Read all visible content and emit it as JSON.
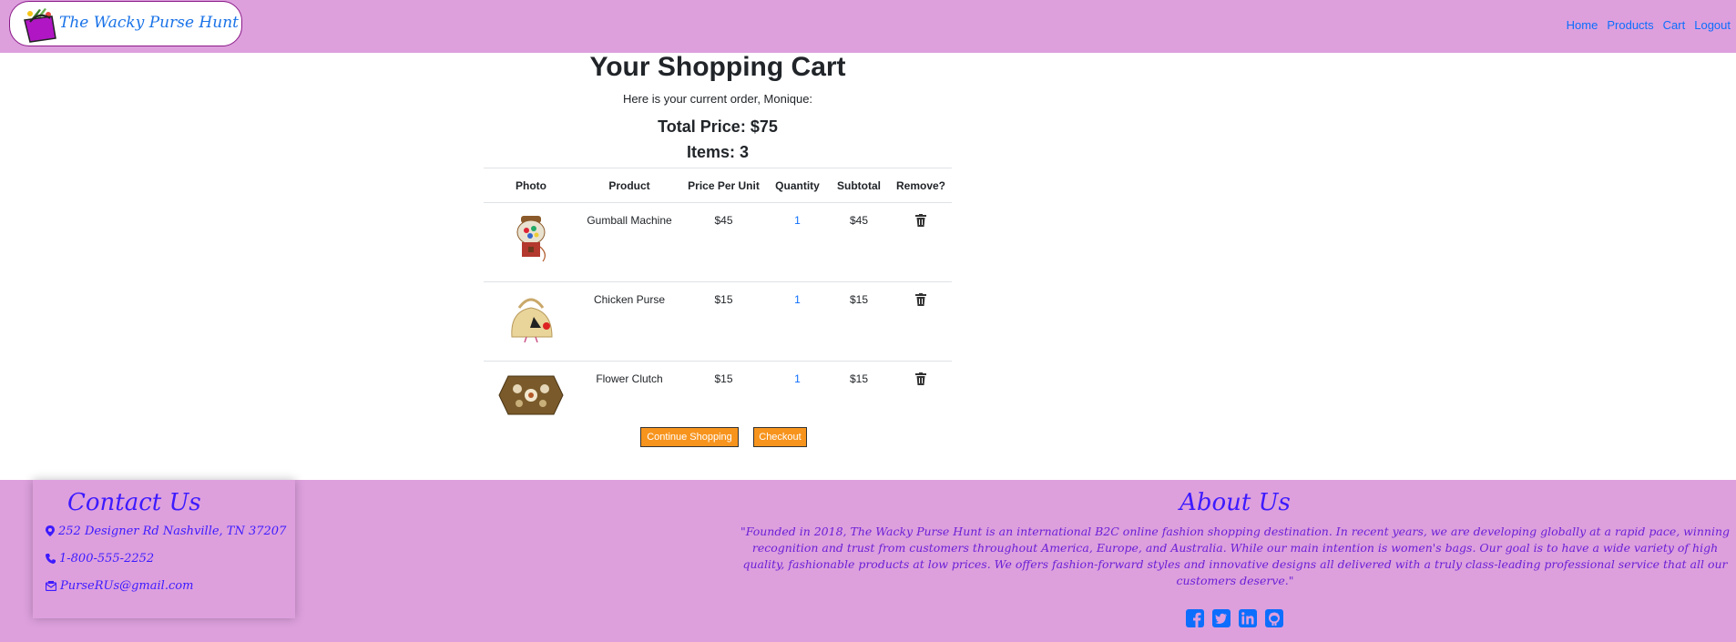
{
  "brand": {
    "name": "The Wacky Purse Hunt",
    "logo_icon": "purse-logo-icon"
  },
  "nav": {
    "links": [
      "Home",
      "Products",
      "Cart",
      "Logout"
    ],
    "color": "#0d6efd"
  },
  "cart": {
    "title": "Your Shopping Cart",
    "subtitle": "Here is your current order, Monique:",
    "total": "Total Price: $75",
    "items": "Items: 3",
    "columns": [
      "Photo",
      "Product",
      "Price Per Unit",
      "Quantity",
      "Subtotal",
      "Remove?"
    ],
    "rows": [
      {
        "product": "Gumball Machine",
        "price": "$45",
        "quantity": "1",
        "subtotal": "$45",
        "icon": "trash-icon"
      },
      {
        "product": "Chicken Purse",
        "price": "$15",
        "quantity": "1",
        "subtotal": "$15",
        "icon": "trash-icon"
      },
      {
        "product": "Flower Clutch",
        "price": "$15",
        "quantity": "1",
        "subtotal": "$15",
        "icon": "trash-icon"
      }
    ],
    "buttons": {
      "continue": "Continue Shopping",
      "checkout": "Checkout"
    }
  },
  "footer": {
    "contact": {
      "title": "Contact Us",
      "address": "252 Designer Rd Nashville, TN 37207",
      "phone": "1-800-555-2252",
      "email": "PurseRUs@gmail.com"
    },
    "about": {
      "title": "About Us",
      "text": "\"Founded in 2018, The Wacky Purse Hunt is an international B2C online fashion shopping destination. In recent years, we are developing globally at a rapid pace, winning recognition and trust from customers throughout America, Europe, and Australia. While our main intention is women's bags. Our goal is to have a wide variety of high quality, fashionable products at low prices. We offers fashion-forward styles and innovative designs all delivered with a truly class-leading professional service that all our customers deserve.\""
    },
    "social_icons": [
      "facebook-icon",
      "twitter-icon",
      "linkedin-icon",
      "github-icon"
    ]
  },
  "colors": {
    "nav_bg": "#dda0dd",
    "button": "#f7941d",
    "accent": "#3d1aff"
  }
}
